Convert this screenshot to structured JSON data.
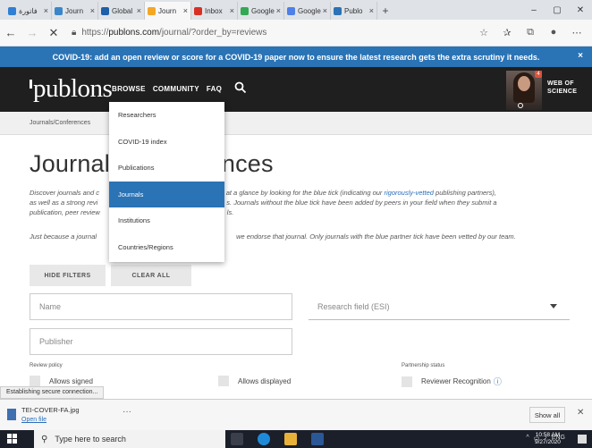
{
  "browser": {
    "tabs": [
      {
        "title": "فاتورة",
        "color": "#2f7fd6",
        "active": false
      },
      {
        "title": "Journ",
        "color": "#3b86c9",
        "active": false
      },
      {
        "title": "Global",
        "color": "#1d5fa8",
        "active": false
      },
      {
        "title": "Journ",
        "color": "#f5a623",
        "active": true
      },
      {
        "title": "Inbox",
        "color": "#d93025",
        "active": false
      },
      {
        "title": "Google",
        "color": "#34a853",
        "active": false
      },
      {
        "title": "Google",
        "color": "#4f7fe8",
        "active": false
      },
      {
        "title": "Publo",
        "color": "#2a73b5",
        "active": false
      }
    ],
    "new_tab_label": "+",
    "window_controls": [
      "–",
      "▢",
      "✕"
    ],
    "url_scheme": "https://",
    "url_host": "publons.com",
    "url_path": "/journal/?order_by=reviews"
  },
  "banner": {
    "text": "COVID-19: add an open review or score for a COVID-19 paper now to ensure the latest research gets the extra scrutiny it needs.",
    "close": "×"
  },
  "header": {
    "logo": "publons",
    "nav": [
      "BROWSE",
      "COMMUNITY",
      "FAQ"
    ],
    "notification_count": "4",
    "wos_line1": "WEB OF",
    "wos_line2": "SCIENCE"
  },
  "breadcrumb": "Journals/Conferences",
  "page": {
    "title_left": "Journals",
    "title_right": "ences",
    "desc_part1": "Discover journals and c",
    "desc_part2": "able titles at a glance by looking for the blue tick (indicating our ",
    "desc_link": "rigorously-vetted",
    "desc_part3": " publishing partners),",
    "desc_line2a": "as well as a strong revi",
    "desc_line2b": "s. Journals without the blue tick have been added by peers in your field when they submit a",
    "desc_line3a": "publication, peer review",
    "desc_line3b": "ls.",
    "desc2a": "Just because a journal",
    "desc2b": "we endorse that journal. Only journals with the blue partner tick have been vetted by our team."
  },
  "filters": {
    "hide_filters": "HIDE FILTERS",
    "clear_all": "CLEAR ALL",
    "name_placeholder": "Name",
    "research_field": "Research field (ESI)",
    "publisher_placeholder": "Publisher",
    "review_policy_label": "Review policy",
    "partnership_label": "Partnership status",
    "allows_signed": "Allows signed",
    "allows_displayed": "Allows displayed",
    "reviewer_recognition": "Reviewer Recognition"
  },
  "browse_menu": {
    "items": [
      "Researchers",
      "COVID-19 index",
      "Publications",
      "Journals",
      "Institutions",
      "Countries/Regions"
    ],
    "active_index": 3
  },
  "status_text": "Establishing secure connection...",
  "download": {
    "filename": "TEI-COVER-FA.jpg",
    "open_label": "Open file",
    "more": "···",
    "show_all": "Show all",
    "close": "✕"
  },
  "taskbar": {
    "search_placeholder": "Type here to search",
    "tray_lang": "ENG",
    "time": "10:58 AM",
    "date": "9/27/2020"
  },
  "colors": {
    "accent": "#2a73b5",
    "header_bg": "#1f1f1f"
  }
}
